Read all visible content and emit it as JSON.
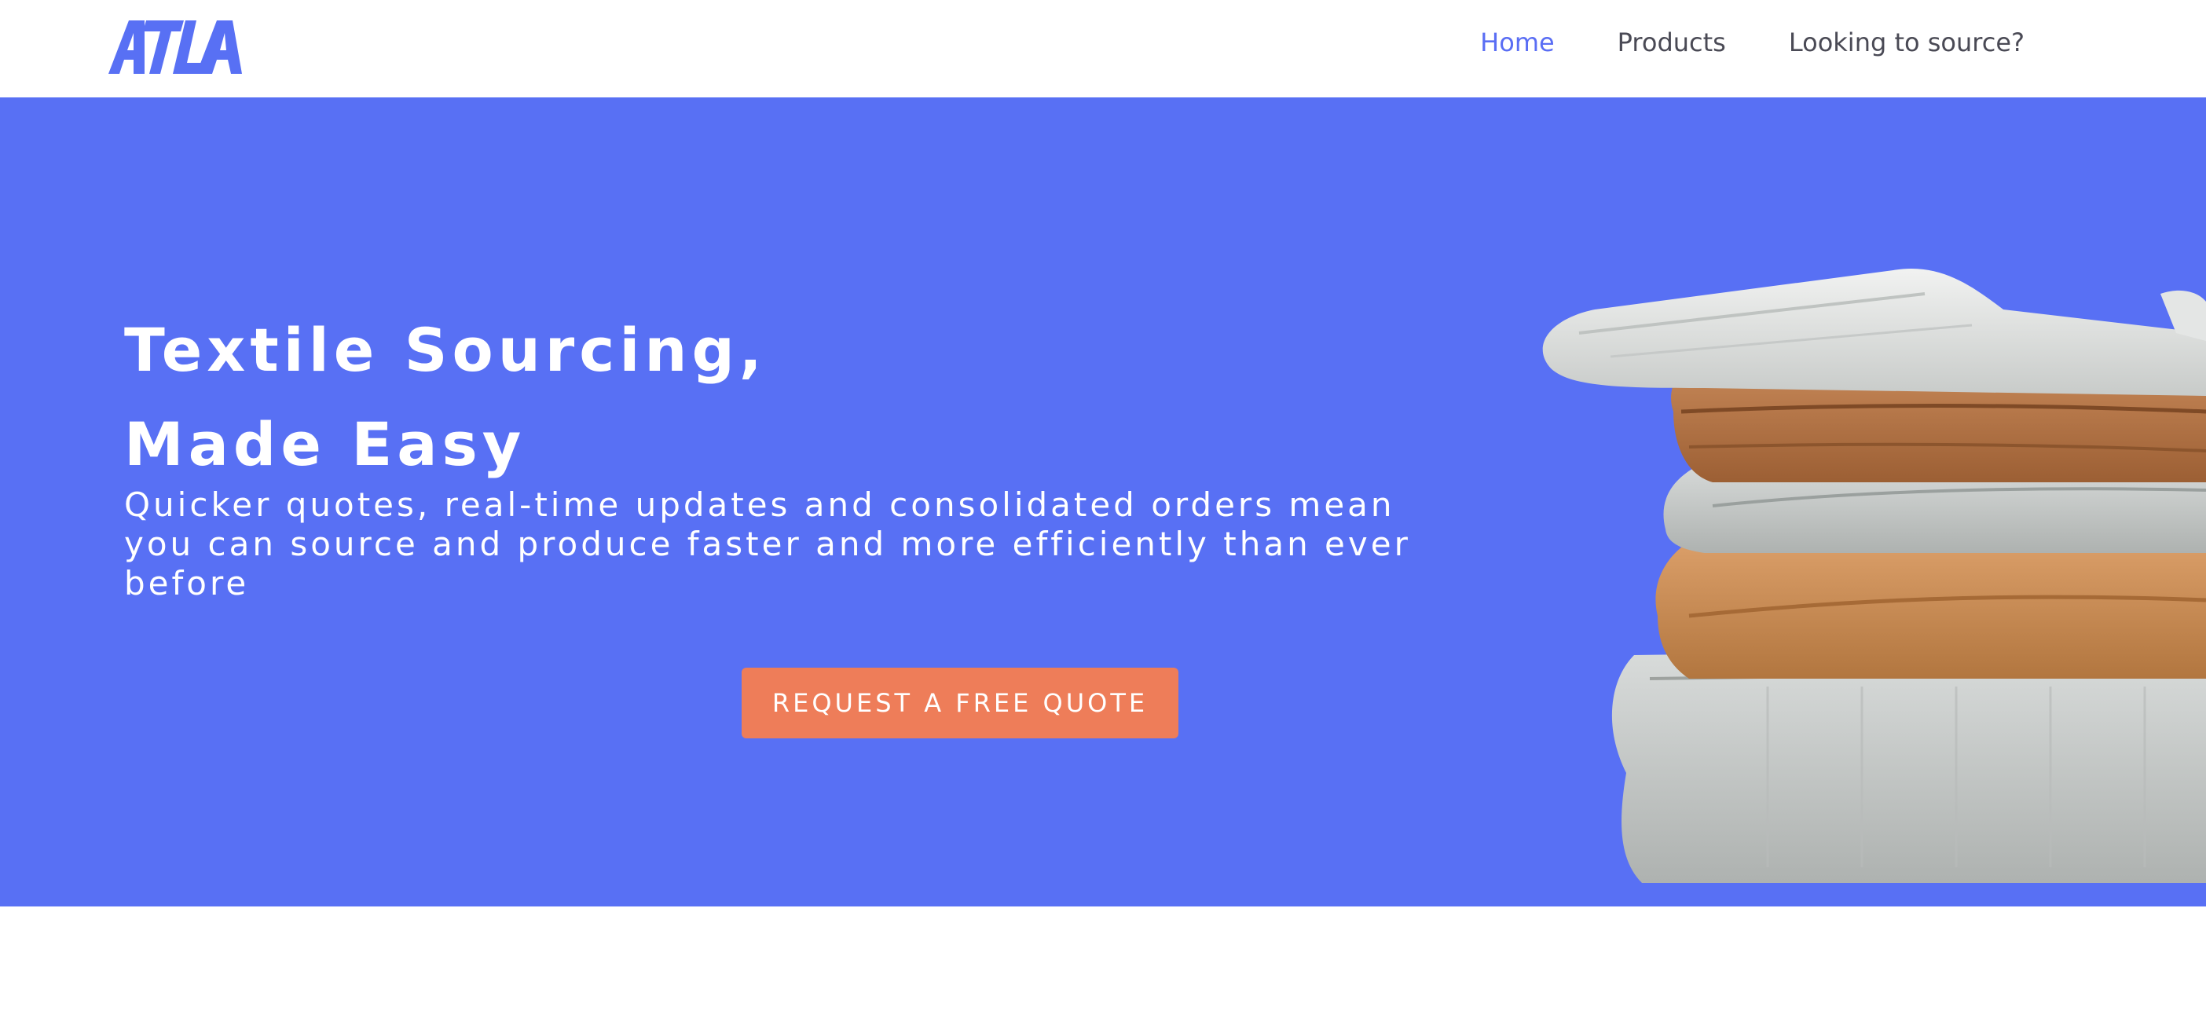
{
  "header": {
    "logo_text": "ATLA",
    "nav": [
      {
        "label": "Home",
        "active": true
      },
      {
        "label": "Products",
        "active": false
      },
      {
        "label": "Looking to source?",
        "active": false
      }
    ]
  },
  "hero": {
    "title_line1": "Textile Sourcing,",
    "title_line2": "Made Easy",
    "subtitle": "Quicker quotes, real-time updates and consolidated orders mean you can source and produce faster and more efficiently than ever before",
    "cta_label": "REQUEST A FREE QUOTE",
    "image_subject": "stack-of-folded-linens"
  },
  "colors": {
    "brand_blue": "#5870f4",
    "nav_active": "#5a6ef4",
    "nav_text": "#4a4a55",
    "cta_orange": "#ee7d59",
    "background": "#ffffff"
  }
}
